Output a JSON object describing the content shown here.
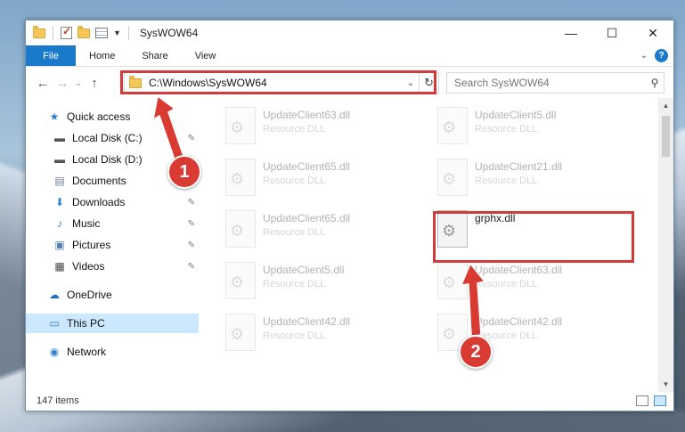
{
  "window": {
    "title": "SysWOW64",
    "controls": {
      "minimize": "—",
      "maximize": "☐",
      "close": "✕"
    }
  },
  "ribbon": {
    "file_tab": "File",
    "tabs": [
      "Home",
      "Share",
      "View"
    ],
    "help": "?"
  },
  "nav": {
    "back": "←",
    "forward": "→",
    "recent": "⌄",
    "up": "↑",
    "address": "C:\\Windows\\SysWOW64",
    "refresh": "↻",
    "search_placeholder": "Search SysWOW64"
  },
  "sidebar": {
    "items": [
      {
        "label": "Quick access",
        "icon": "★"
      },
      {
        "label": "Local Disk (C:)",
        "icon": "▬"
      },
      {
        "label": "Local Disk (D:)",
        "icon": "▬"
      },
      {
        "label": "Documents",
        "icon": "▤"
      },
      {
        "label": "Downloads",
        "icon": "⬇"
      },
      {
        "label": "Music",
        "icon": "♪"
      },
      {
        "label": "Pictures",
        "icon": "▣"
      },
      {
        "label": "Videos",
        "icon": "▦"
      },
      {
        "label": "OneDrive",
        "icon": "☁"
      },
      {
        "label": "This PC",
        "icon": "▭"
      },
      {
        "label": "Network",
        "icon": "◉"
      }
    ],
    "pin_icon": "📌"
  },
  "files": [
    {
      "name": "UpdateClient63.dll",
      "type": "Resource DLL",
      "faded": true
    },
    {
      "name": "UpdateClient5.dll",
      "type": "Resource DLL",
      "faded": true
    },
    {
      "name": "UpdateClient65.dll",
      "type": "Resource DLL",
      "faded": true
    },
    {
      "name": "UpdateClient21.dll",
      "type": "Resource DLL",
      "faded": true
    },
    {
      "name": "UpdateClient65.dll",
      "type": "Resource DLL",
      "faded": true
    },
    {
      "name": "grphx.dll",
      "type": "",
      "faded": false
    },
    {
      "name": "UpdateClient5.dll",
      "type": "Resource DLL",
      "faded": true
    },
    {
      "name": "UpdateClient63.dll",
      "type": "Resource DLL",
      "faded": true
    },
    {
      "name": "UpdateClient42.dll",
      "type": "Resource DLL",
      "faded": true
    },
    {
      "name": "UpdateClient42.dll",
      "type": "Resource DLL",
      "faded": true
    }
  ],
  "status": {
    "item_count": "147 items"
  },
  "annotations": {
    "badge1": "1",
    "badge2": "2",
    "color": "#d93a32"
  }
}
